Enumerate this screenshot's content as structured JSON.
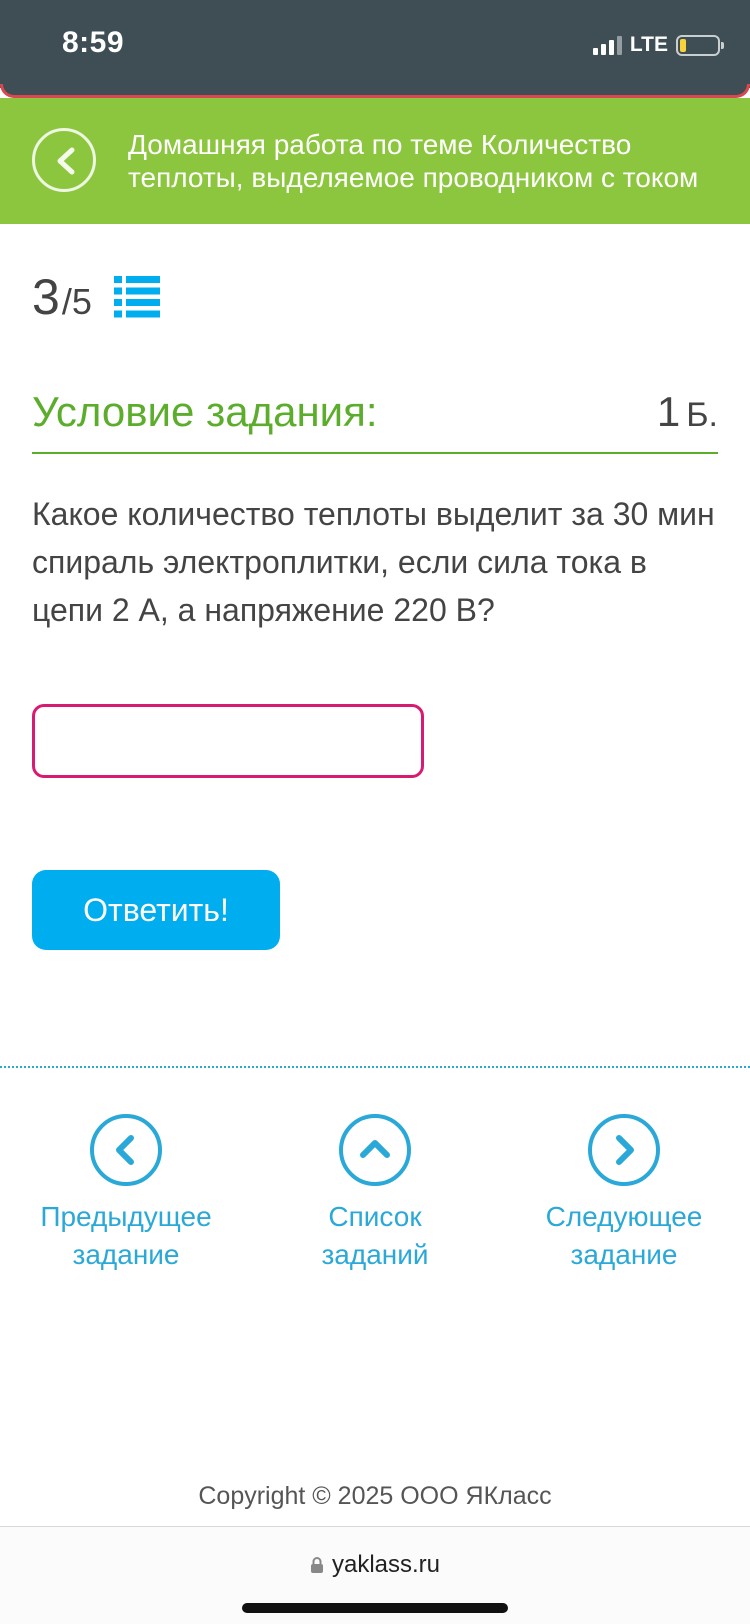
{
  "status_bar": {
    "time": "8:59",
    "network": "LTE"
  },
  "header": {
    "title": "Домашняя работа по теме Количество теплоты, выделяемое проводником с током"
  },
  "counter": {
    "current": "3",
    "total": "/5"
  },
  "condition": {
    "title": "Условие задания:",
    "points": "1",
    "points_unit": "Б."
  },
  "question": {
    "text": "Какое количество теплоты выделит за 30 мин спираль электроплитки, если сила тока в цепи 2 А, а напряжение 220 В?"
  },
  "answer": {
    "value": "",
    "button_label": "Ответить!"
  },
  "nav": {
    "prev_line1": "Предыдущее",
    "prev_line2": "задание",
    "list_line1": "Список",
    "list_line2": "заданий",
    "next_line1": "Следующее",
    "next_line2": "задание"
  },
  "footer": {
    "copyright": "Copyright © 2025 ООО ЯКласс"
  },
  "browser": {
    "url": "yaklass.ru"
  },
  "colors": {
    "header_green": "#8cc63f",
    "title_green": "#5cad2b",
    "accent_blue": "#00aeef",
    "input_border": "#d81b72",
    "status_bar": "#3f4d55"
  },
  "icons": [
    "back-icon",
    "task-list-icon",
    "chevron-left-icon",
    "chevron-up-icon",
    "chevron-right-icon",
    "lock-icon",
    "signal-icon",
    "battery-icon"
  ]
}
